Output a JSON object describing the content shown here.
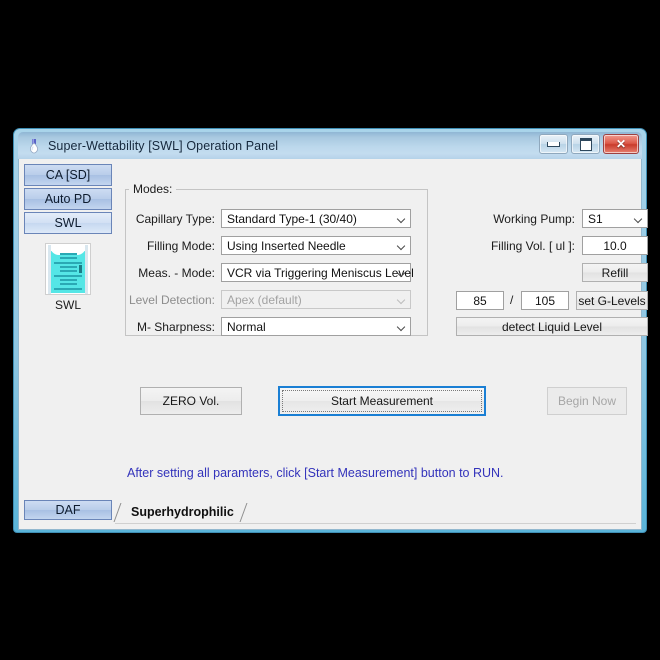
{
  "window": {
    "title": "Super-Wettability [SWL] Operation Panel",
    "icon": "droplet-icon",
    "minimize_label": "minimize-icon",
    "maximize_label": "maximize-icon",
    "close_label": "✕"
  },
  "sidebar": {
    "tabs": [
      {
        "label": "CA [SD]",
        "selected": false
      },
      {
        "label": "Auto PD",
        "selected": false
      },
      {
        "label": "SWL",
        "selected": true
      }
    ],
    "preview_icon": "capillary-beaker-icon",
    "preview_label": "SWL",
    "bottom_tab": "DAF"
  },
  "modes": {
    "group_title": "Modes:",
    "fields": [
      {
        "label": "Capillary Type:",
        "value": "Standard Type-1 (30/40)",
        "disabled": false
      },
      {
        "label": "Filling Mode:",
        "value": "Using Inserted Needle",
        "disabled": false
      },
      {
        "label": "Meas. - Mode:",
        "value": "VCR via Triggering Meniscus Level",
        "disabled": false
      },
      {
        "label": "Level Detection:",
        "value": "Apex (default)",
        "disabled": true
      },
      {
        "label": "M- Sharpness:",
        "value": "Normal",
        "disabled": false
      }
    ]
  },
  "pump_panel": {
    "working_pump_label": "Working Pump:",
    "working_pump_value": "S1",
    "filling_vol_label": "Filling Vol. [ ul ]:",
    "filling_vol_value": "10.0",
    "refill_label": "Refill",
    "glevel_low": "85",
    "glevel_separator": "/",
    "glevel_high": "105",
    "set_glevels_label": "set G-Levels",
    "detect_liquid_label": "detect Liquid Level"
  },
  "actions": {
    "zero_vol_label": "ZERO Vol.",
    "start_measurement_label": "Start Measurement",
    "begin_now_label": "Begin Now"
  },
  "hint": "After setting all paramters, click [Start Measurement] button to RUN.",
  "bottom_tabs": [
    {
      "label": "Superhydrophilic",
      "selected": true
    }
  ]
}
